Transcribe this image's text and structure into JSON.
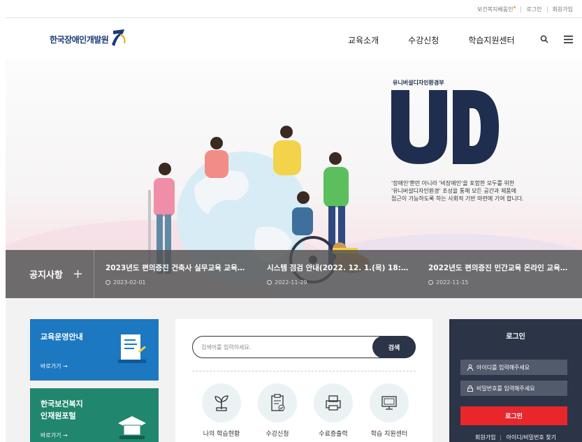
{
  "topbar": {
    "links": [
      "보건복지배움인",
      "로그인",
      "회원가입"
    ]
  },
  "header": {
    "logo_text": "한국장애인개발원",
    "nav": [
      "교육소개",
      "수강신청",
      "학습지원센터"
    ],
    "icons": [
      "search-icon",
      "menu-icon"
    ]
  },
  "hero": {
    "ud_caption": "유니버설디자인환경부",
    "ud_letters": "UD",
    "description": [
      "'장애인'뿐만 아니라 '비장애인'을 포함한 모두를 위한",
      "'유니버설디자인환경' 조성을 통해 모든 공간과 제품에",
      "접근이 가능하도록 하는 사회적 기반 마련에 기여 합니다."
    ]
  },
  "notice": {
    "heading": "공지사항",
    "plus": "+",
    "items": [
      {
        "title": "2023년도 편의증진 건축사 실무교육 교육…",
        "date": "2023-02-01"
      },
      {
        "title": "시스템 점검 안내(2022. 12. 1.(목) 18:00…",
        "date": "2022-11-29"
      },
      {
        "title": "2022년도 편의증진 민간교육 온라인 교육…",
        "date": "2022-11-15"
      }
    ]
  },
  "cards": [
    {
      "title_lines": [
        "교육운영안내"
      ],
      "more": "바로가기 →",
      "color": "#1c78c0"
    },
    {
      "title_lines": [
        "한국보건복지",
        "인재원포털"
      ],
      "more": "바로가기 →",
      "color": "#21866e"
    }
  ],
  "search": {
    "placeholder": "검색어를 입력하세요.",
    "button": "검색"
  },
  "quick_links": [
    {
      "label": "나의 학습현황",
      "icon": "plant-icon"
    },
    {
      "label": "수강신청",
      "icon": "clipboard-check-icon"
    },
    {
      "label": "수료증출력",
      "icon": "printer-icon"
    },
    {
      "label": "학습 지원센터",
      "icon": "monitor-icon"
    }
  ],
  "login": {
    "title": "로그인",
    "id_placeholder": "아이디를 입력해주세요",
    "pw_placeholder": "비밀번호를 입력해주세요",
    "button": "로그인",
    "links": [
      "회원가입",
      "아이디/비밀번호 찾기"
    ]
  },
  "colors": {
    "brand_navy": "#1b3a78",
    "login_bg": "#2c3447",
    "login_button": "#e8262b",
    "card_blue": "#1c78c0",
    "card_green": "#21866e"
  }
}
